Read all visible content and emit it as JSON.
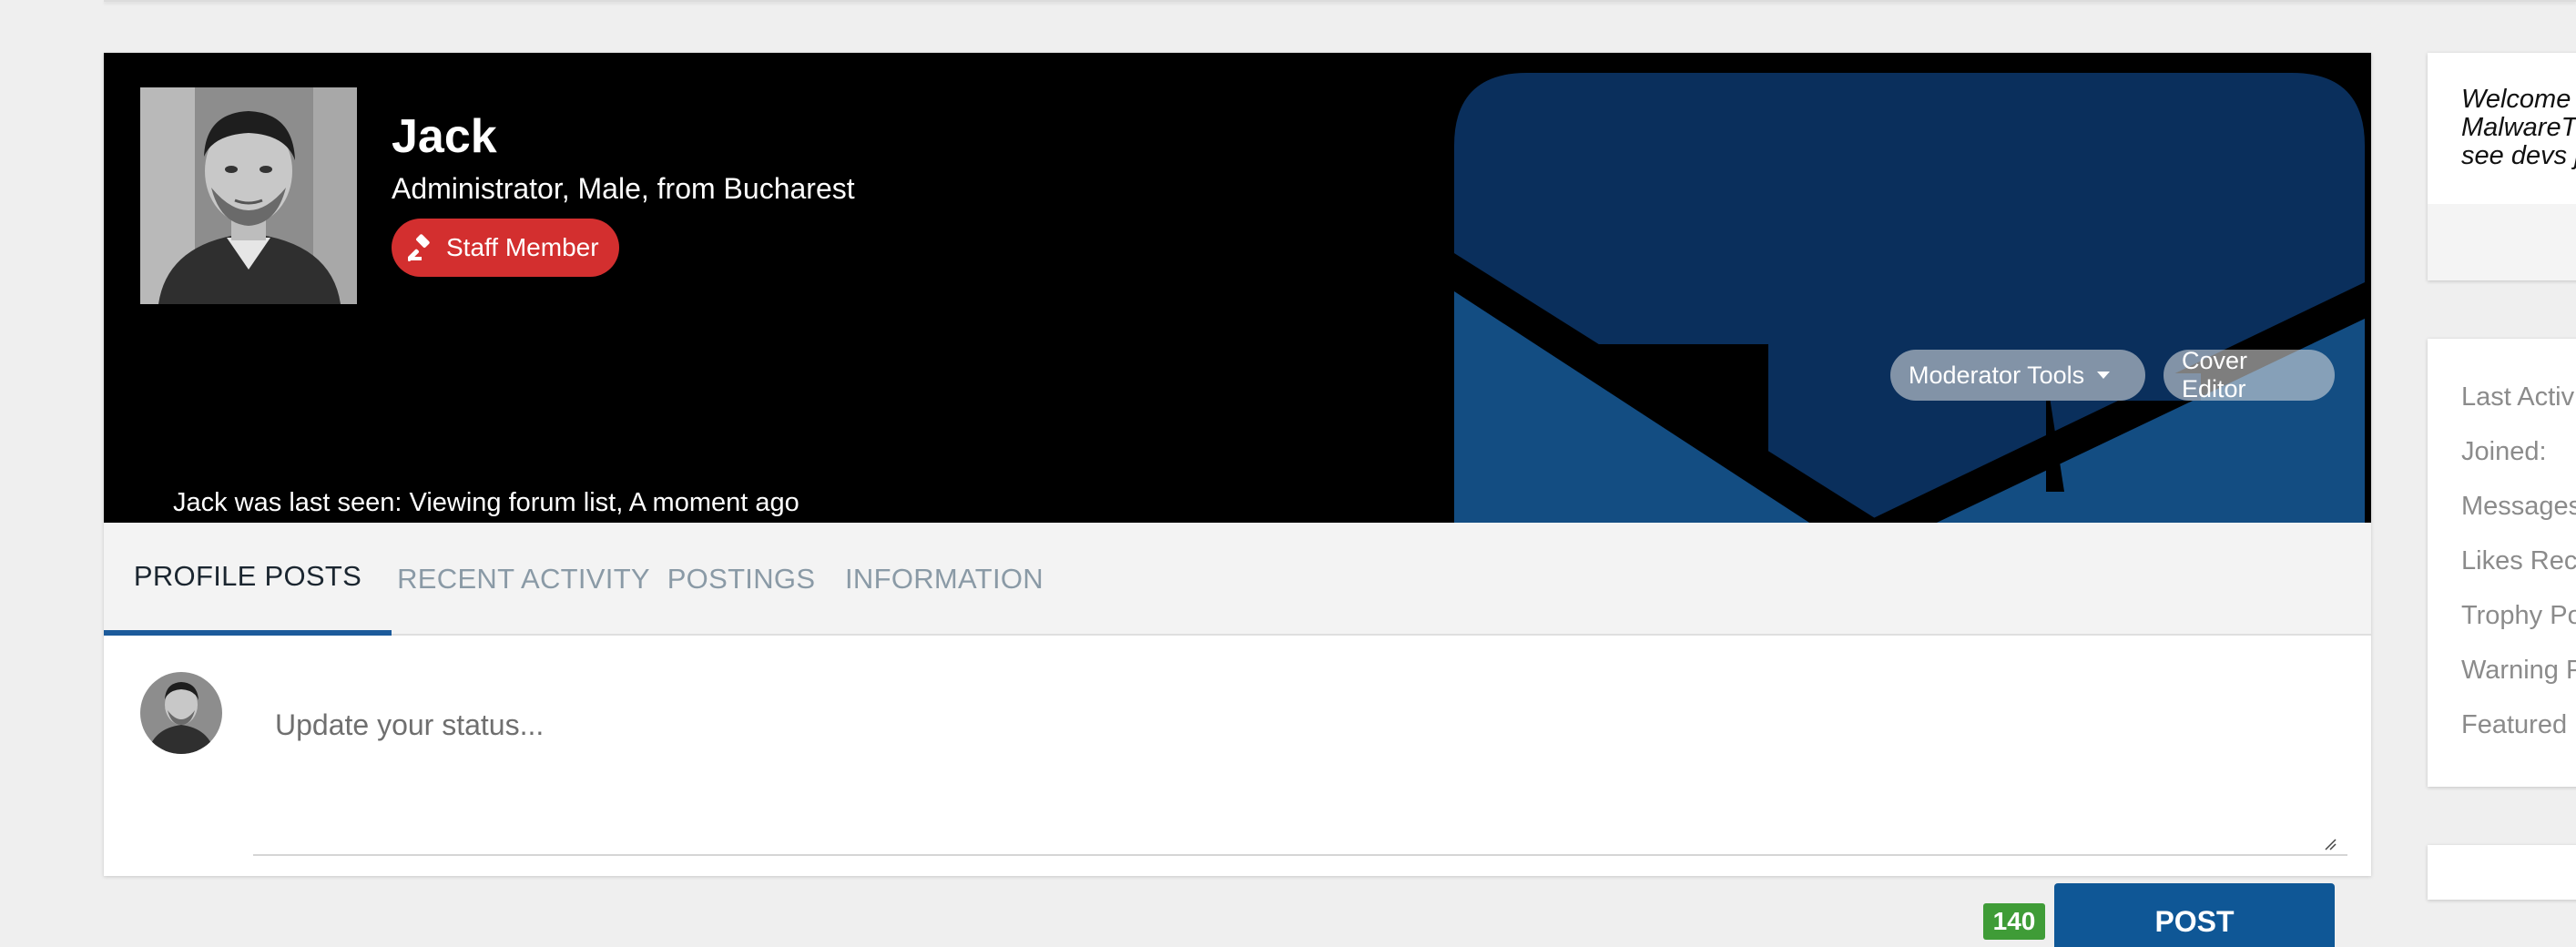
{
  "profile": {
    "name": "Jack",
    "subtitle": "Administrator, Male, from Bucharest",
    "badge": "Staff Member",
    "last_seen": "Jack was last seen: Viewing forum list, A moment ago",
    "avatar_icon": "user-photo"
  },
  "cover_actions": {
    "moderator_tools": "Moderator Tools",
    "cover_editor": "Cover Editor"
  },
  "tabs": [
    {
      "label": "PROFILE POSTS",
      "active": true
    },
    {
      "label": "RECENT ACTIVITY",
      "active": false
    },
    {
      "label": "POSTINGS",
      "active": false
    },
    {
      "label": "INFORMATION",
      "active": false
    }
  ],
  "composer": {
    "placeholder": "Update your status...",
    "char_count": "140",
    "post_label": "POST"
  },
  "sidebar": {
    "welcome_lines": [
      "Welcome",
      "MalwareT",
      "see devs j"
    ],
    "stats": [
      "Last Activ",
      "Joined:",
      "Messages",
      "Likes Rec",
      "Trophy Po",
      "Warning P",
      "Featured"
    ]
  },
  "colors": {
    "accent": "#1c5b9b",
    "badge": "#d32f2f",
    "post_button": "#0f5796",
    "counter": "#3f9c37",
    "cover_art_dark": "#0a2f5c",
    "cover_art_light": "#134d82"
  }
}
